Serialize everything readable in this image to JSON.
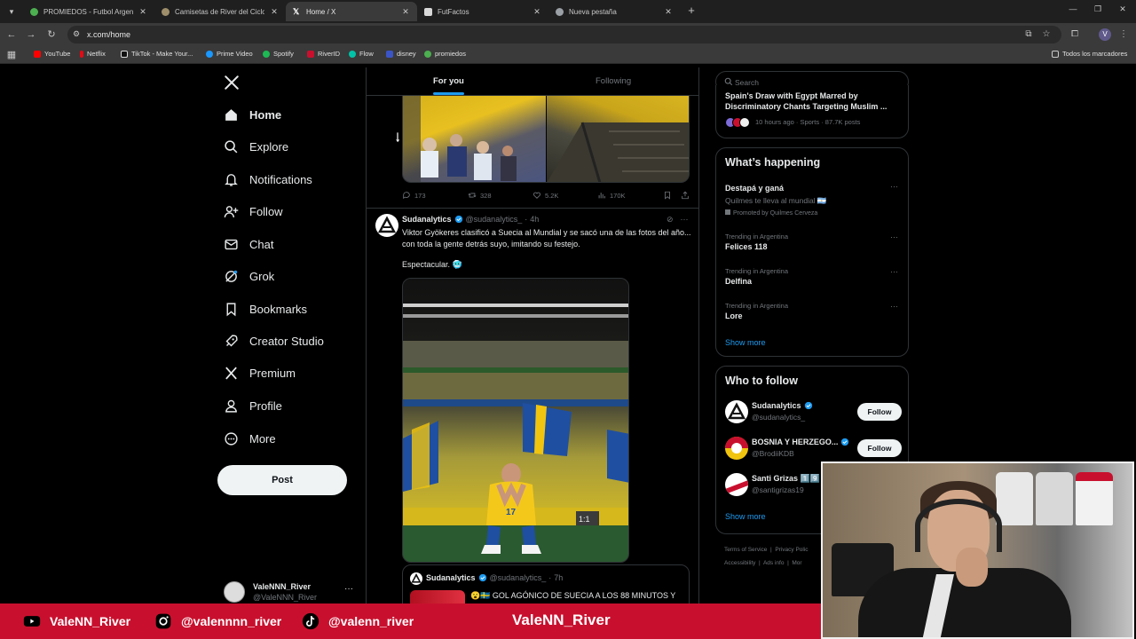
{
  "browser": {
    "tabs": [
      {
        "label": "PROMIEDOS - Futbol Argentino",
        "favicon_color": "#4caf50"
      },
      {
        "label": "Camisetas de River del Ciclo Ga",
        "favicon_color": "#9e8e6a"
      },
      {
        "label": "Home / X",
        "favicon_color": "#ffffff"
      },
      {
        "label": "FutFactos",
        "favicon_color": "#d8d8d8"
      },
      {
        "label": "Nueva pestaña",
        "favicon_color": "#9aa0a6"
      }
    ],
    "active_tab": 2,
    "url": "x.com/home",
    "profile_initial": "V",
    "bookmarks": [
      {
        "label": "YouTube",
        "color": "#ff0000"
      },
      {
        "label": "Netflix",
        "color": "#e50914"
      },
      {
        "label": "TikTok - Make Your...",
        "color": "#111111"
      },
      {
        "label": "Prime Video",
        "color": "#1a98ff"
      },
      {
        "label": "Spotify",
        "color": "#1db954"
      },
      {
        "label": "RiverID",
        "color": "#c8102e"
      },
      {
        "label": "Flow",
        "color": "#00c2a8"
      },
      {
        "label": "disney",
        "color": "#3b55c6"
      },
      {
        "label": "promiedos",
        "color": "#4caf50"
      }
    ],
    "all_bookmarks": "Todos los marcadores"
  },
  "nav": {
    "items": [
      {
        "label": "Home",
        "icon": "home-icon"
      },
      {
        "label": "Explore",
        "icon": "search-icon"
      },
      {
        "label": "Notifications",
        "icon": "bell-icon"
      },
      {
        "label": "Follow",
        "icon": "add-person-icon"
      },
      {
        "label": "Chat",
        "icon": "envelope-icon"
      },
      {
        "label": "Grok",
        "icon": "grok-icon"
      },
      {
        "label": "Bookmarks",
        "icon": "bookmark-icon"
      },
      {
        "label": "Creator Studio",
        "icon": "rocket-icon"
      },
      {
        "label": "Premium",
        "icon": "x-icon"
      },
      {
        "label": "Profile",
        "icon": "person-icon"
      },
      {
        "label": "More",
        "icon": "more-circle-icon"
      }
    ],
    "post_label": "Post",
    "account": {
      "name": "ValeNNN_River",
      "handle": "@ValeNNN_River"
    }
  },
  "timeline": {
    "tabs": [
      "For you",
      "Following"
    ],
    "prev_post_stats": {
      "replies": "173",
      "reposts": "328",
      "likes": "5.2K",
      "views": "170K"
    },
    "post": {
      "author": "Sudanalytics",
      "handle": "@sudanalytics_",
      "time": "4h",
      "text": "Viktor Gyökeres clasificó a Suecia al Mundial y se sacó una de las fotos del año... con toda la gente detrás suyo, imitando su festejo.",
      "text2": "Espectacular. 🥶",
      "player_number": "17",
      "quote": {
        "author": "Sudanalytics",
        "handle": "@sudanalytics_",
        "time": "7h",
        "text": "😮🇸🇪 GOL AGÓNICO DE SUECIA A LOS 88 MINUTOS Y"
      }
    }
  },
  "sidebar": {
    "search_placeholder": "Search",
    "news": {
      "title": "Spain's Draw with Egypt Marred by Discriminatory Chants Targeting Muslim ...",
      "meta": "10 hours ago · Sports · 87.7K posts"
    },
    "happening": {
      "title": "What’s happening",
      "promo": {
        "name": "Destapá y ganá",
        "sub": "Quilmes te lleva al mundial 🇦🇷",
        "promoted": "Promoted by Quilmes Cerveza"
      },
      "trends": [
        {
          "context": "Trending in Argentina",
          "name": "Felices 118"
        },
        {
          "context": "Trending in Argentina",
          "name": "Delfina"
        },
        {
          "context": "Trending in Argentina",
          "name": "Lore"
        }
      ],
      "show_more": "Show more"
    },
    "who_to_follow": {
      "title": "Who to follow",
      "accounts": [
        {
          "name": "Sudanalytics",
          "handle": "@sudanalytics_",
          "button": "Follow"
        },
        {
          "name": "BOSNIA Y HERZEGO...",
          "handle": "@BrodiiKDB",
          "button": "Follow"
        },
        {
          "name": "Santi Grizas 1️⃣9️⃣",
          "handle": "@santigrizas19",
          "button": ""
        }
      ],
      "show_more": "Show more"
    },
    "footer": [
      "Terms of Service",
      "Privacy Polic",
      "Accessibility",
      "Ads info",
      "Mor"
    ]
  },
  "overlay": {
    "socials": [
      {
        "label": "ValeNN_River",
        "icon": "youtube-icon"
      },
      {
        "label": "@valennnn_river",
        "icon": "instagram-icon"
      },
      {
        "label": "@valenn_river",
        "icon": "tiktok-icon"
      }
    ],
    "center_label": "ValeNN_River"
  }
}
